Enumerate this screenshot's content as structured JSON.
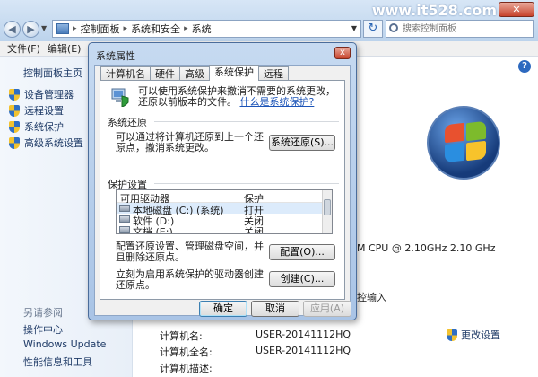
{
  "explorer": {
    "breadcrumb": [
      "控制面板",
      "系统和安全",
      "系统"
    ],
    "search_placeholder": "搜索控制面板",
    "watermark": "www.it528.com"
  },
  "menu": {
    "file": "文件(F)",
    "edit": "编辑(E)",
    "view": "查"
  },
  "sidebar": {
    "home": "控制面板主页",
    "items": [
      "设备管理器",
      "远程设置",
      "系统保护",
      "高级系统设置"
    ],
    "see_also": "另请参阅",
    "links": [
      "操作中心",
      "Windows Update",
      "性能信息和工具"
    ]
  },
  "main": {
    "processor_text": "M CPU @ 2.10GHz   2.10 GHz",
    "pen_text": "控输入",
    "computer_name_label": "计算机名:",
    "computer_name_value": "USER-20141112HQ",
    "full_name_label": "计算机全名:",
    "full_name_value": "USER-20141112HQ",
    "description_label": "计算机描述:",
    "change_settings": "更改设置"
  },
  "dialog": {
    "title": "系统属性",
    "close": "x",
    "tabs": [
      "计算机名",
      "硬件",
      "高级",
      "系统保护",
      "远程"
    ],
    "active_tab": "系统保护",
    "intro_text": "可以使用系统保护来撤消不需要的系统更改，还原以前版本的文件。",
    "intro_link": "什么是系统保护?",
    "restore_group": "系统还原",
    "restore_text": "可以通过将计算机还原到上一个还原点，撤消系统更改。",
    "restore_button": "系统还原(S)...",
    "protect_group": "保护设置",
    "drive_columns": [
      "可用驱动器",
      "保护"
    ],
    "drives": [
      {
        "name": "本地磁盘 (C:) (系统)",
        "protection": "打开"
      },
      {
        "name": "软件 (D:)",
        "protection": "关闭"
      },
      {
        "name": "文档 (E:)",
        "protection": "关闭"
      }
    ],
    "config_text": "配置还原设置、管理磁盘空间，并且删除还原点。",
    "config_button": "配置(O)...",
    "create_text": "立刻为启用系统保护的驱动器创建还原点。",
    "create_button": "创建(C)...",
    "ok": "确定",
    "cancel": "取消",
    "apply": "应用(A)"
  }
}
